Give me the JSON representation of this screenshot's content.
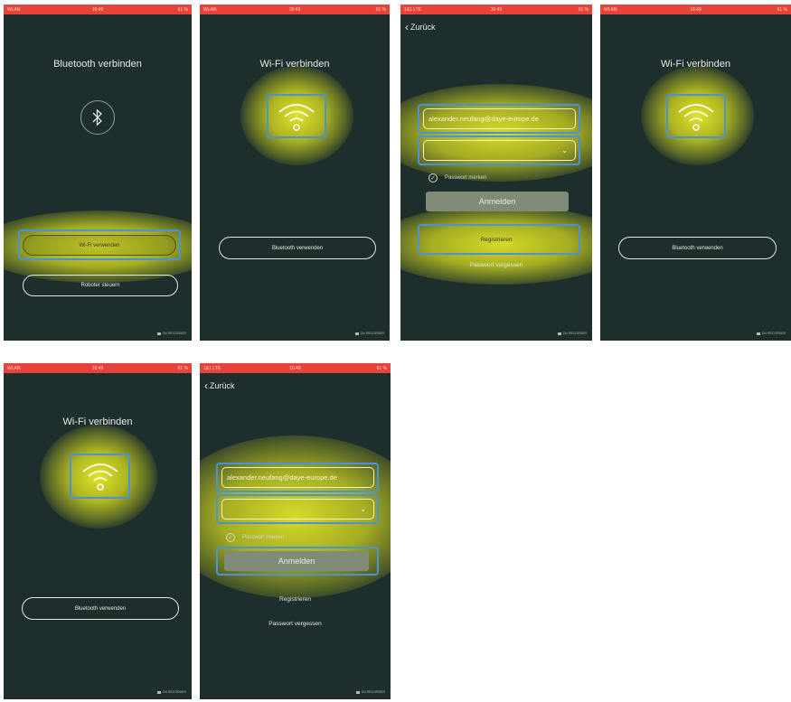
{
  "status": {
    "s1": {
      "carrier": "WLAN",
      "time": "16:49",
      "battery": "61 %"
    },
    "s2": {
      "carrier": "WLAN",
      "time": "16:49",
      "battery": "61 %"
    },
    "s3": {
      "carrier": "1&1 LTE",
      "time": "16:49",
      "battery": "61 %"
    },
    "s4": {
      "carrier": "WLAN",
      "time": "16:49",
      "battery": "61 %"
    },
    "s5": {
      "carrier": "WLAN",
      "time": "16:49",
      "battery": "61 %"
    },
    "s6": {
      "carrier": "1&1 LTE",
      "time": "16:49",
      "battery": "61 %"
    }
  },
  "nav": {
    "back_label": "Zurück"
  },
  "titles": {
    "bluetooth": "Bluetooth verbinden",
    "wifi": "Wi-Fi verbinden"
  },
  "buttons": {
    "use_wifi": "Wi-Fi verwenden",
    "control_robot": "Roboter steuern",
    "use_bluetooth": "Bluetooth verwenden",
    "login": "Anmelden",
    "register": "Registrieren",
    "forgot_password": "Passwort vergessen"
  },
  "login": {
    "email_value": "alexander.neufang@daye-europe.de",
    "password_value": "",
    "remember_label": "Passwort merken"
  },
  "recorder_badge": "DU RECORDER",
  "colors": {
    "screen_bg": "#1e2e2c",
    "status_bar": "#e8433a",
    "highlight_glow": "#e6e628",
    "focus_box": "#4a93d6",
    "login_button": "#7f8c77"
  },
  "icons": [
    "bluetooth-icon",
    "wifi-icon",
    "chevron-left-icon",
    "chevron-down-icon",
    "checkmark-icon",
    "camera-icon"
  ]
}
